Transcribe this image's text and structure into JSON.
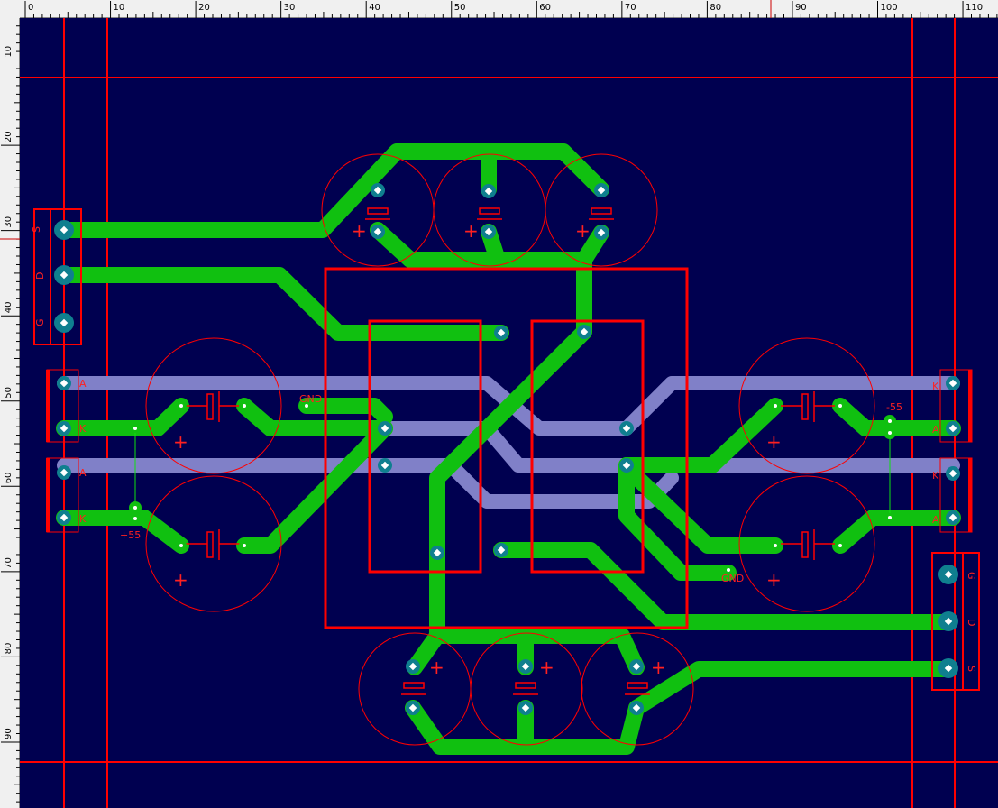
{
  "ruler": {
    "unit": "mm",
    "top_ticks": [
      "0",
      "10",
      "20",
      "30",
      "40",
      "50",
      "60",
      "70",
      "80",
      "90",
      "100",
      "110"
    ],
    "left_ticks": [
      "10",
      "20",
      "30",
      "40",
      "50",
      "60",
      "70",
      "80",
      "90"
    ]
  },
  "labels": {
    "src_header_top": [
      "S",
      "D",
      "G"
    ],
    "src_header_bottom": [
      "G",
      "D",
      "S"
    ],
    "a": "A",
    "k": "K",
    "plus_55": "+55",
    "minus_55": "-55",
    "gnd": "GND",
    "plus": "+"
  },
  "colors": {
    "board": "#000050",
    "top_copper": "#10c010",
    "bottom_copper": "#8080c8",
    "outline": "#ff0000",
    "pad": "#0f7f8f"
  }
}
